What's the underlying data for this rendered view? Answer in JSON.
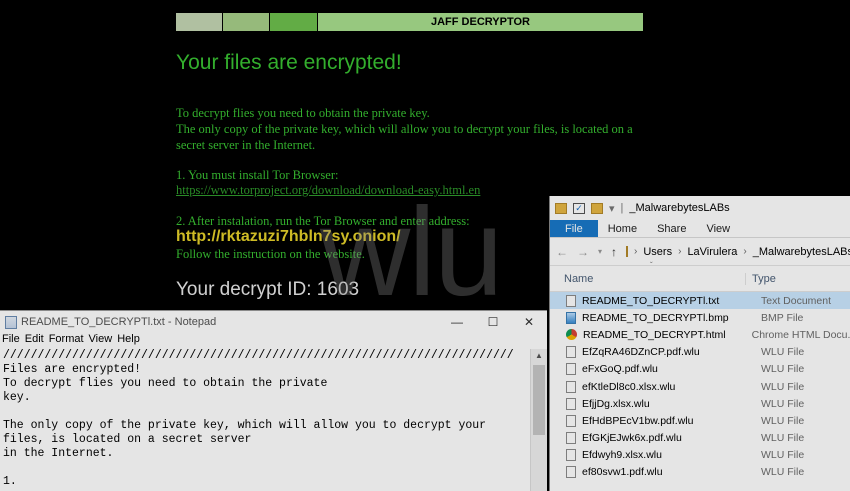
{
  "ransom_note": {
    "banner_title": "JAFF DECRYPTOR",
    "heading": "Your files are encrypted!",
    "para1_line1": "To decrypt flies you need to obtain the private key.",
    "para1_line2": "The only copy of the private key, which will allow you to decrypt your files, is located on a",
    "para1_line3": "secret server in the Internet.",
    "step1": "1. You must install Tor Browser:",
    "tor_url": "https://www.torproject.org/download/download-easy.html.en",
    "step2": "2. After instalation, run the Tor Browser and enter address:",
    "onion_address": "http://rktazuzi7hbln7sy.onion/",
    "follow": "Follow the instruction on the website.",
    "decrypt_id": "Your decrypt ID: 1603"
  },
  "watermark": "wlu",
  "notepad": {
    "title": "README_TO_DECRYPTl.txt - Notepad",
    "menu": [
      "File",
      "Edit",
      "Format",
      "View",
      "Help"
    ],
    "controls": [
      "—",
      "☐",
      "✕"
    ],
    "lines": [
      "//////////////////////////////////////////////////////////////////////////",
      "Files are encrypted!",
      "To decrypt flies you need to obtain the private",
      "key.",
      "",
      "The only copy of the private key, which will allow you to decrypt your",
      "files, is located on a secret server",
      "in the Internet.",
      "",
      "1."
    ]
  },
  "explorer": {
    "title": "_MalwarebytesLABs",
    "ribbon_tabs": [
      "File",
      "Home",
      "Share",
      "View"
    ],
    "breadcrumb": [
      "Users",
      "LaVirulera",
      "_MalwarebytesLABs"
    ],
    "columns": {
      "name": "Name",
      "type": "Type"
    },
    "files": [
      {
        "name": "README_TO_DECRYPTl.txt",
        "type": "Text Document",
        "icon": "txt-icon",
        "selected": true
      },
      {
        "name": "README_TO_DECRYPTl.bmp",
        "type": "BMP File",
        "icon": "bmp-icon"
      },
      {
        "name": "README_TO_DECRYPT.html",
        "type": "Chrome HTML Docu...",
        "icon": "chrome-icon"
      },
      {
        "name": "EfZqRA46DZnCP.pdf.wlu",
        "type": "WLU File",
        "icon": "file-icon"
      },
      {
        "name": "eFxGoQ.pdf.wlu",
        "type": "WLU File",
        "icon": "file-icon"
      },
      {
        "name": "efKtleDl8c0.xlsx.wlu",
        "type": "WLU File",
        "icon": "file-icon"
      },
      {
        "name": "EfjjDg.xlsx.wlu",
        "type": "WLU File",
        "icon": "file-icon"
      },
      {
        "name": "EfHdBPEcV1bw.pdf.wlu",
        "type": "WLU File",
        "icon": "file-icon"
      },
      {
        "name": "EfGKjEJwk6x.pdf.wlu",
        "type": "WLU File",
        "icon": "file-icon"
      },
      {
        "name": "Efdwyh9.xlsx.wlu",
        "type": "WLU File",
        "icon": "file-icon"
      },
      {
        "name": "ef80svw1.pdf.wlu",
        "type": "WLU File",
        "icon": "file-icon"
      }
    ]
  }
}
